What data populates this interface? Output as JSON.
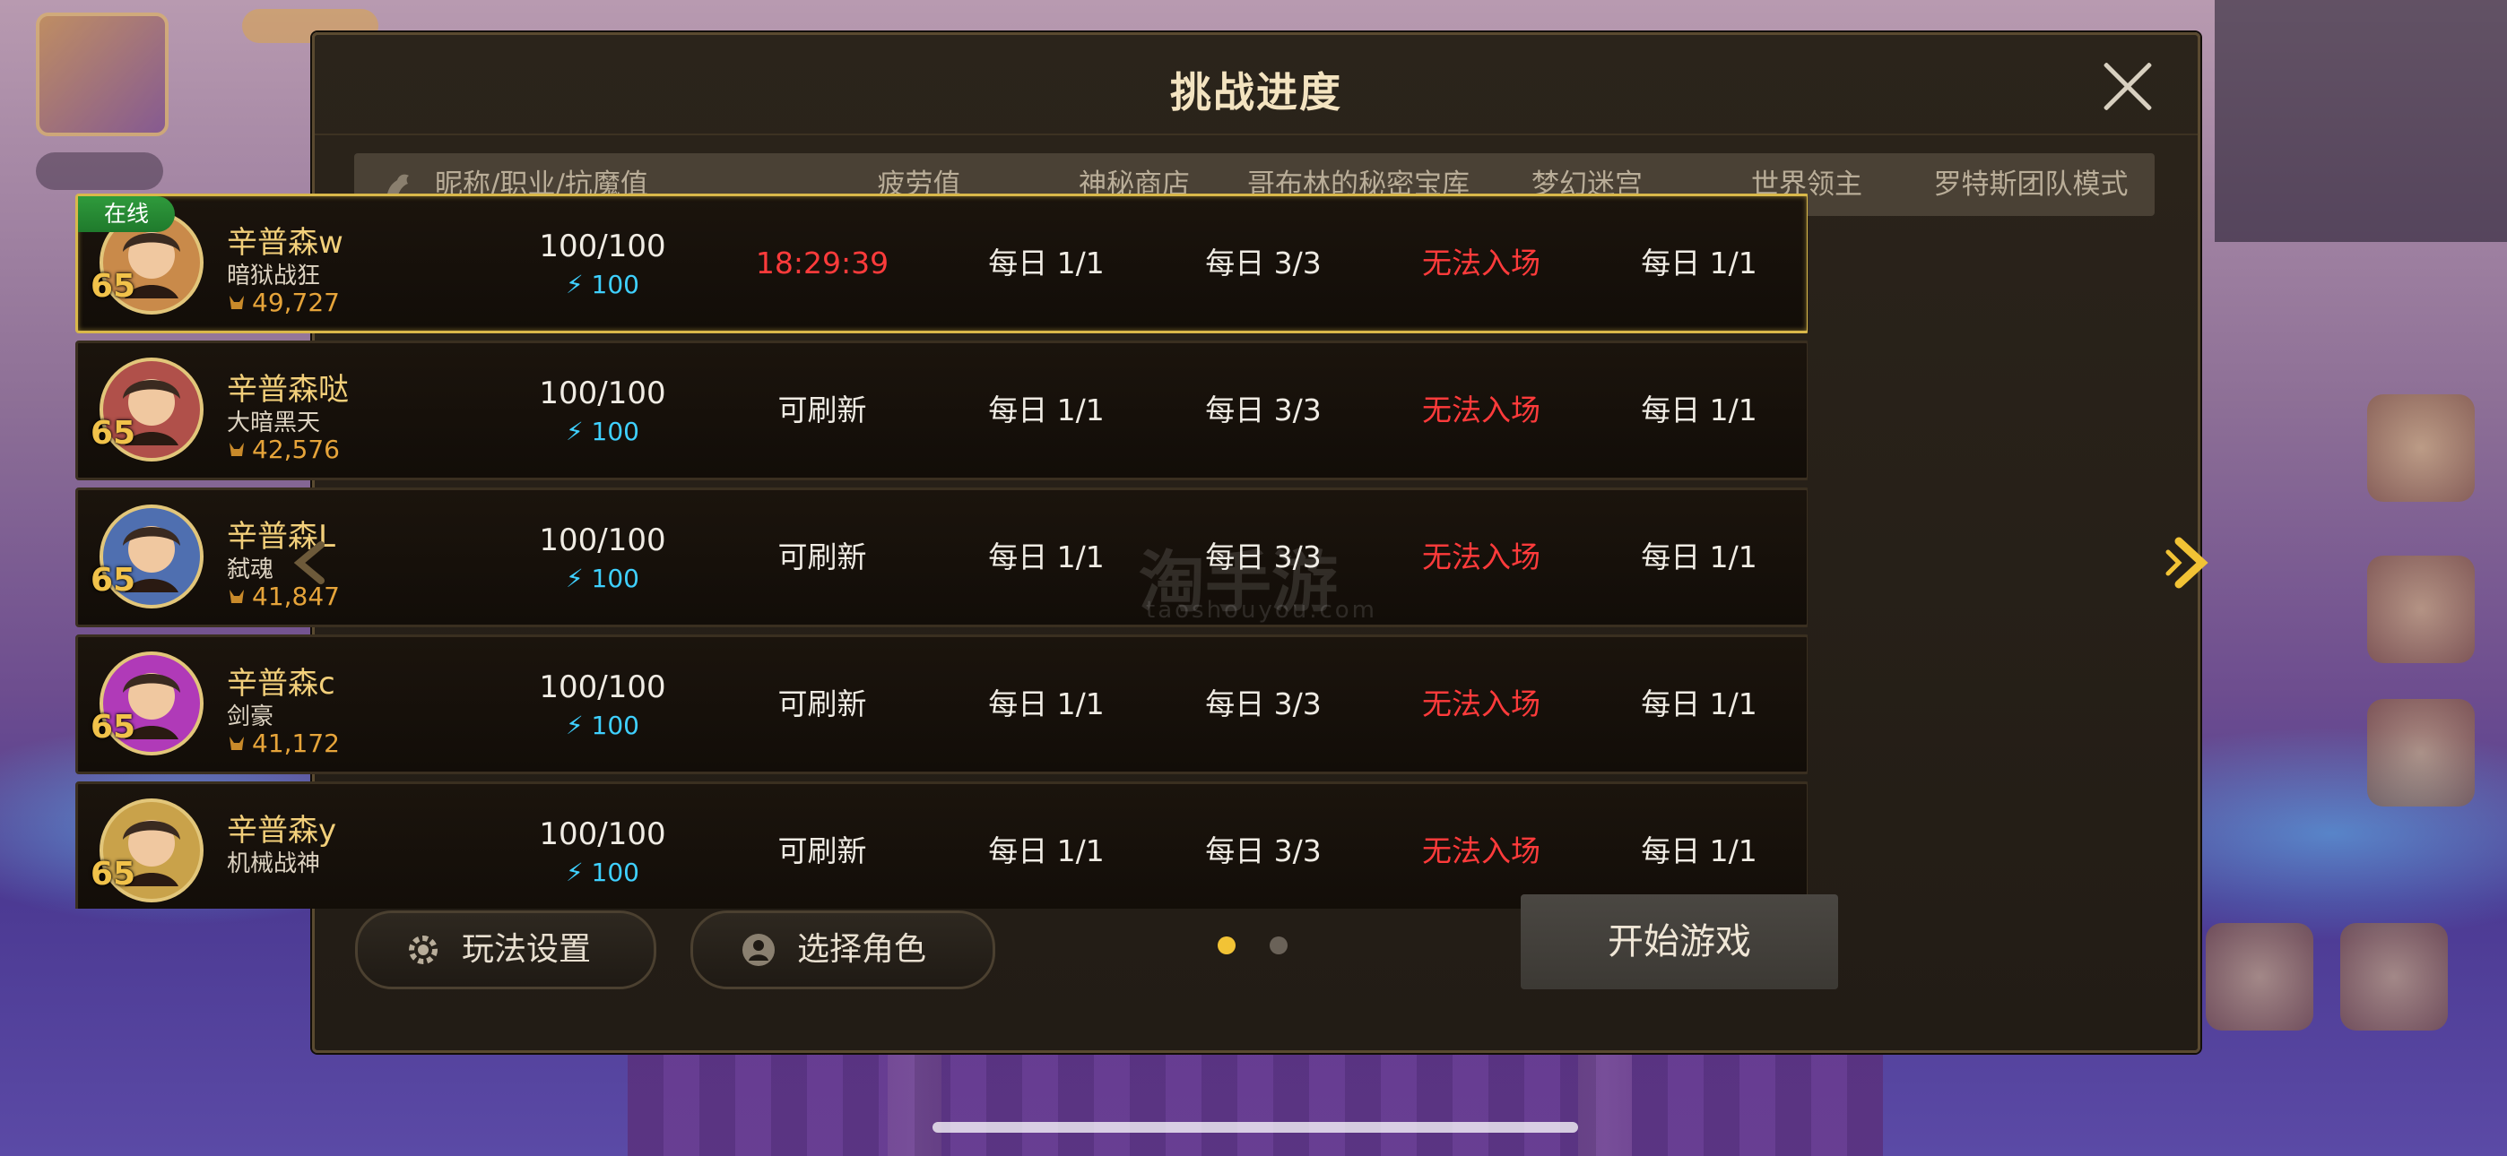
{
  "dialog": {
    "title": "挑战进度",
    "columns": [
      "昵称/职业/抗魔值",
      "疲劳值",
      "神秘商店",
      "哥布林的秘密宝库",
      "梦幻迷宫",
      "世界领主",
      "罗特斯团队模式"
    ],
    "characters": [
      {
        "online": "在线",
        "level": "65",
        "name": "辛普森w",
        "job": "暗狱战狂",
        "power": "49,727",
        "fatigue": "100/100",
        "fatigue_sub": "100",
        "shop": "18:29:39",
        "goblin": "每日 1/1",
        "maze": "每日 3/3",
        "lord": "无法入场",
        "raid": "每日 1/1",
        "portrait_color": "#c98a4a"
      },
      {
        "online": "",
        "level": "65",
        "name": "辛普森哒",
        "job": "大暗黑天",
        "power": "42,576",
        "fatigue": "100/100",
        "fatigue_sub": "100",
        "shop": "可刷新",
        "goblin": "每日 1/1",
        "maze": "每日 3/3",
        "lord": "无法入场",
        "raid": "每日 1/1",
        "portrait_color": "#b0504a"
      },
      {
        "online": "",
        "level": "65",
        "name": "辛普森L",
        "job": "弑魂",
        "power": "41,847",
        "fatigue": "100/100",
        "fatigue_sub": "100",
        "shop": "可刷新",
        "goblin": "每日 1/1",
        "maze": "每日 3/3",
        "lord": "无法入场",
        "raid": "每日 1/1",
        "portrait_color": "#4f6fb0"
      },
      {
        "online": "",
        "level": "65",
        "name": "辛普森c",
        "job": "剑豪",
        "power": "41,172",
        "fatigue": "100/100",
        "fatigue_sub": "100",
        "shop": "可刷新",
        "goblin": "每日 1/1",
        "maze": "每日 3/3",
        "lord": "无法入场",
        "raid": "每日 1/1",
        "portrait_color": "#b03ab8"
      },
      {
        "online": "",
        "level": "65",
        "name": "辛普森y",
        "job": "机械战神",
        "power": "",
        "fatigue": "100/100",
        "fatigue_sub": "100",
        "shop": "可刷新",
        "goblin": "每日 1/1",
        "maze": "每日 3/3",
        "lord": "无法入场",
        "raid": "每日 1/1",
        "portrait_color": "#c9a24a"
      }
    ],
    "buttons": {
      "settings": "玩法设置",
      "select_role": "选择角色",
      "start": "开始游戏"
    },
    "pagination": {
      "active_color": "#f2c335",
      "inactive_color": "#6a6258",
      "current": 1,
      "total": 2
    }
  },
  "watermark": {
    "text": "淘手游",
    "sub": "taoshouyou.com"
  },
  "colors": {
    "accent_gold": "#d9b84a",
    "warning_red": "#ff3b3b",
    "fatigue_blue": "#3fd0ff"
  }
}
